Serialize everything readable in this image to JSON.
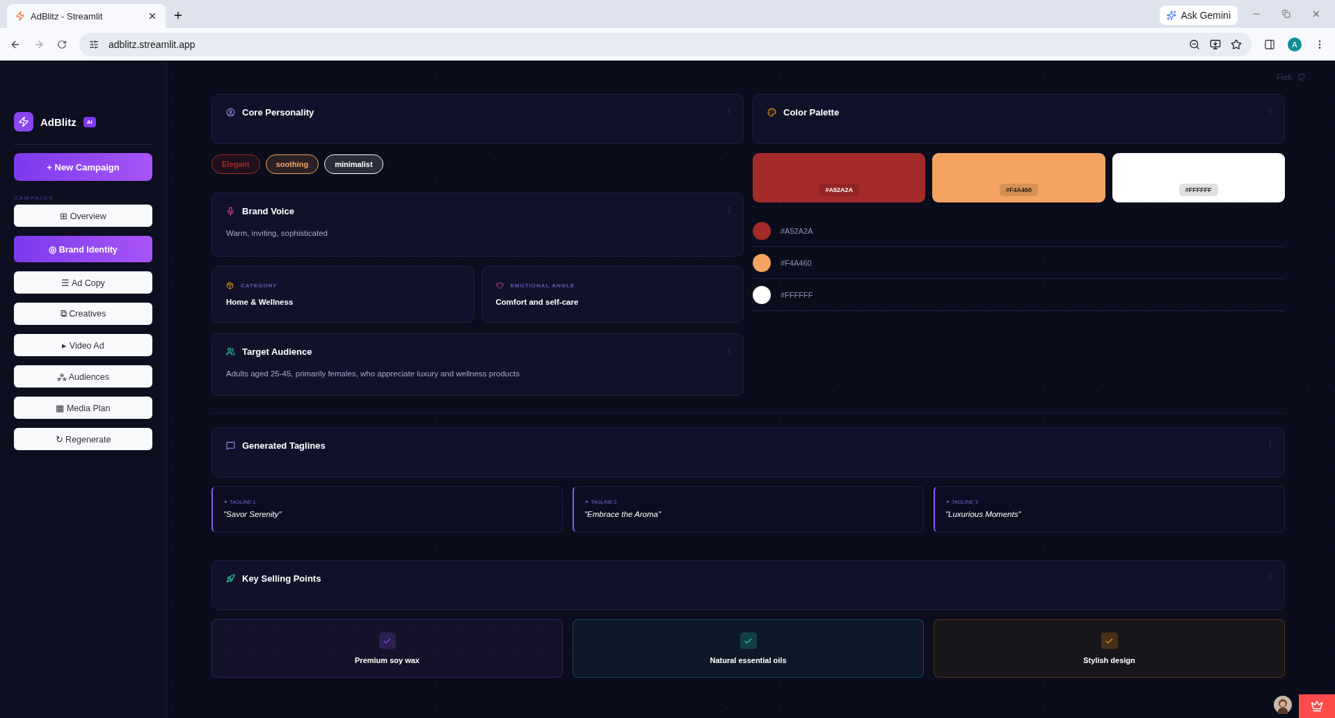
{
  "browser": {
    "tab_title": "AdBlitz - Streamlit",
    "url": "adblitz.streamlit.app",
    "gemini": "Ask Gemini",
    "profile": "A"
  },
  "header": {
    "fork": "Fork"
  },
  "sidebar": {
    "brand": "AdBlitz",
    "badge": "AI",
    "new_campaign": "+ New Campaign",
    "section": "CAMPAIGN",
    "items": [
      {
        "label": "⊞ Overview",
        "selected": false
      },
      {
        "label": "◎ Brand Identity",
        "selected": true
      },
      {
        "label": "☰ Ad Copy",
        "selected": false
      },
      {
        "label": "⧉ Creatives",
        "selected": false
      },
      {
        "label": "▸ Video Ad",
        "selected": false
      },
      {
        "label": "⁂ Audiences",
        "selected": false
      },
      {
        "label": "▦ Media Plan",
        "selected": false
      },
      {
        "label": "↻ Regenerate",
        "selected": false
      }
    ]
  },
  "core_personality": {
    "title": "Core Personality",
    "traits": [
      {
        "label": "Elegant",
        "color": "#a52a2a"
      },
      {
        "label": "soothing",
        "color": "#f4a460"
      },
      {
        "label": "minimalist",
        "color": "#ffffff"
      }
    ]
  },
  "brand_voice": {
    "title": "Brand Voice",
    "text": "Warm, inviting, sophisticated"
  },
  "facts": [
    {
      "kind": "category",
      "label": "CATEGORY",
      "value": "Home & Wellness"
    },
    {
      "kind": "emotion",
      "label": "EMOTIONAL ANGLE",
      "value": "Comfort and self-care"
    }
  ],
  "target_audience": {
    "title": "Target Audience",
    "text": "Adults aged 25-45, primarily females, who appreciate luxury and wellness products"
  },
  "color_palette": {
    "title": "Color Palette",
    "colors": [
      {
        "hex": "#A52A2A",
        "color": "#a52a2a"
      },
      {
        "hex": "#F4A460",
        "color": "#f4a460"
      },
      {
        "hex": "#FFFFFF",
        "color": "#ffffff"
      }
    ],
    "list": [
      {
        "hex": "#A52A2A",
        "color": "#a52a2a"
      },
      {
        "hex": "#F4A460",
        "color": "#f4a460"
      },
      {
        "hex": "#FFFFFF",
        "color": "#ffffff"
      }
    ]
  },
  "taglines": {
    "title": "Generated Taglines",
    "items": [
      {
        "label": "✦ TAGLINE 1",
        "text": "\"Savor Serenity\""
      },
      {
        "label": "✦ TAGLINE 2",
        "text": "\"Embrace the Aroma\""
      },
      {
        "label": "✦ TAGLINE 3",
        "text": "\"Luxurious Moments\""
      }
    ]
  },
  "selling_points": {
    "title": "Key Selling Points",
    "items": [
      {
        "text": "Premium soy wax",
        "color": "#8b5cf6"
      },
      {
        "text": "Natural essential oils",
        "color": "#2dd4bf"
      },
      {
        "text": "Stylish design",
        "color": "#f59e0b"
      }
    ]
  }
}
